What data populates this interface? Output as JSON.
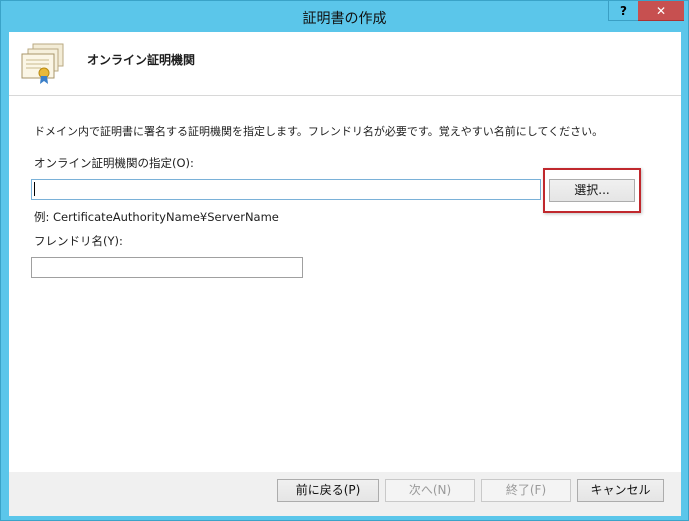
{
  "window": {
    "title": "証明書の作成",
    "help_label": "?",
    "close_label": "✕"
  },
  "header": {
    "title": "オンライン証明機関"
  },
  "body": {
    "description": "ドメイン内で証明書に署名する証明機関を指定します。フレンドリ名が必要です。覚えやすい名前にしてください。",
    "ca_label": "オンライン証明機関の指定(O):",
    "ca_value": "",
    "browse_label": "選択...",
    "example_text": "例: CertificateAuthorityName¥ServerName",
    "friendly_label": "フレンドリ名(Y):",
    "friendly_value": ""
  },
  "footer": {
    "back_label": "前に戻る(P)",
    "next_label": "次へ(N)",
    "finish_label": "終了(F)",
    "cancel_label": "キャンセル"
  },
  "colors": {
    "titlebar": "#5bc6ea",
    "close": "#c75050",
    "highlight": "#c0282d"
  }
}
